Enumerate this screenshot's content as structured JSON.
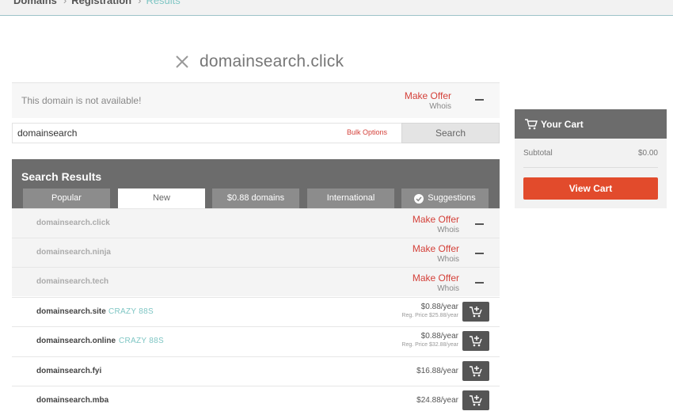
{
  "breadcrumb": [
    "Domains",
    "Registration",
    "Results"
  ],
  "heading": {
    "query": "domainsearch.click"
  },
  "availability": {
    "message": "This domain is not available!",
    "make_offer": "Make Offer",
    "whois": "Whois"
  },
  "search": {
    "value": "domainsearch",
    "bulk_options": "Bulk Options",
    "button": "Search"
  },
  "results": {
    "title": "Search Results",
    "tabs": [
      {
        "label": "Popular",
        "selected": false
      },
      {
        "label": "New",
        "selected": true
      },
      {
        "label": "$0.88 domains",
        "selected": false
      },
      {
        "label": "International",
        "selected": false
      },
      {
        "label": "Suggestions",
        "selected": false,
        "icon": "check-circle-icon"
      }
    ],
    "rows": [
      {
        "domain": "domainsearch.click",
        "available": false,
        "make_offer": "Make Offer",
        "whois": "Whois"
      },
      {
        "domain": "domainsearch.ninja",
        "available": false,
        "make_offer": "Make Offer",
        "whois": "Whois"
      },
      {
        "domain": "domainsearch.tech",
        "available": false,
        "make_offer": "Make Offer",
        "whois": "Whois"
      },
      {
        "domain": "domainsearch.site",
        "available": true,
        "tag": "CRAZY 88S",
        "price": "$0.88/year",
        "reg_price": "Reg. Price $25.88/year"
      },
      {
        "domain": "domainsearch.online",
        "available": true,
        "tag": "CRAZY 88S",
        "price": "$0.88/year",
        "reg_price": "Reg. Price $32.88/year"
      },
      {
        "domain": "domainsearch.fyi",
        "available": true,
        "price": "$16.88/year"
      },
      {
        "domain": "domainsearch.mba",
        "available": true,
        "price": "$24.88/year"
      }
    ]
  },
  "cart": {
    "title": "Your Cart",
    "subtotal_label": "Subtotal",
    "subtotal_value": "$0.00",
    "view_cart": "View Cart"
  },
  "colors": {
    "accent_red": "#d4413a",
    "button_red": "#e24b2c",
    "teal": "#7fc6c4",
    "panel_gray": "#6c6c6c"
  }
}
